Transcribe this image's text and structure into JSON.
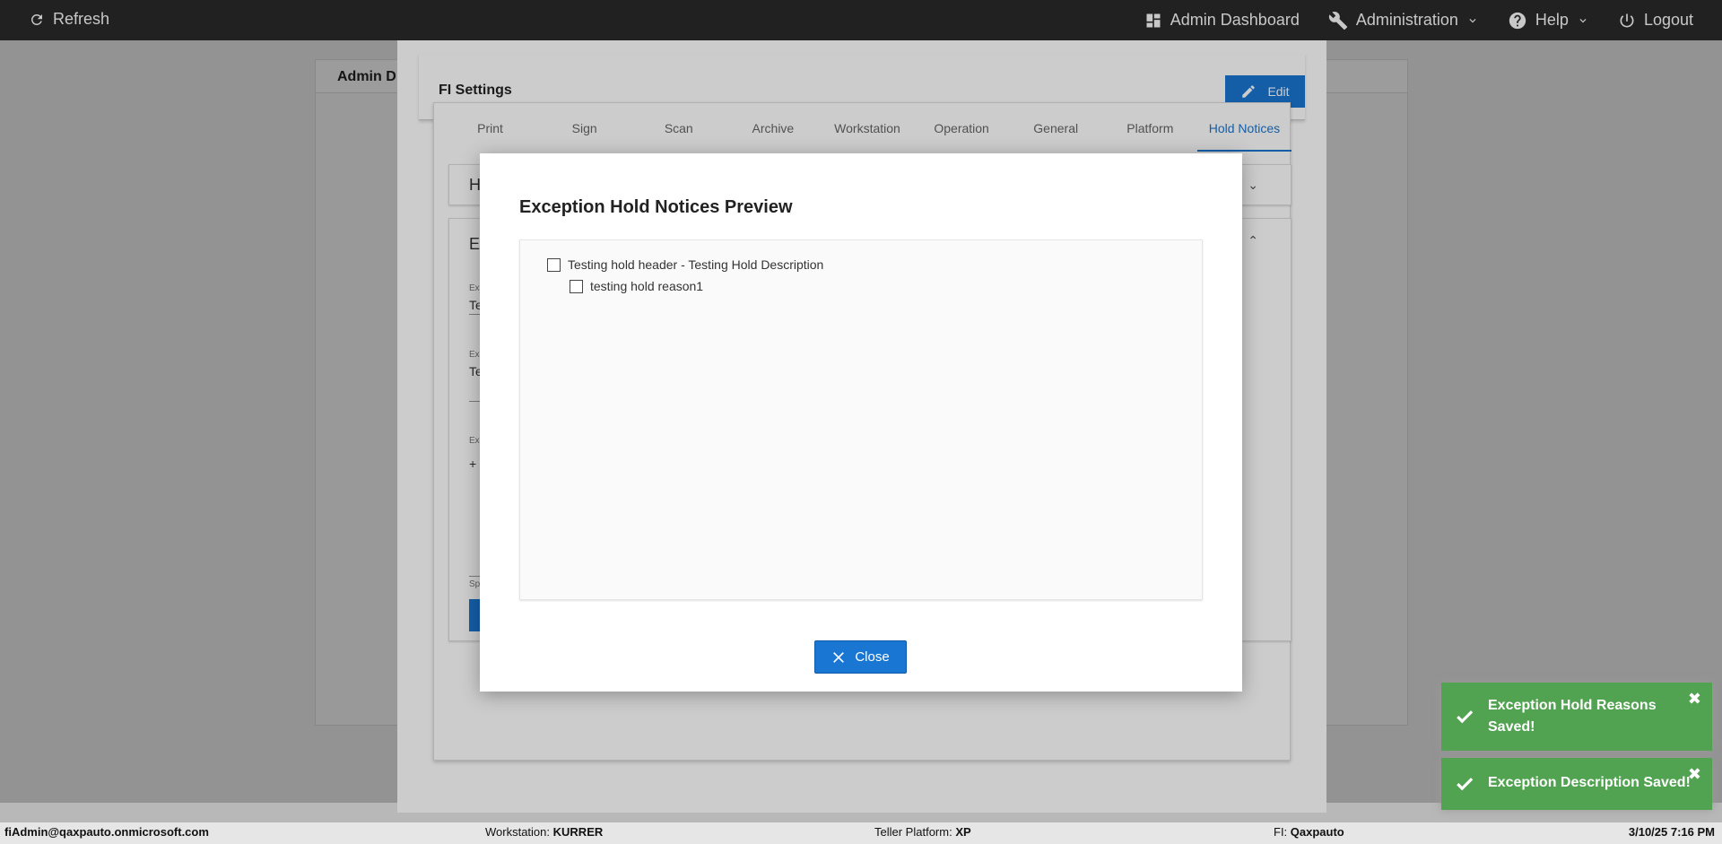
{
  "topbar": {
    "refresh": "Refresh",
    "admin_dashboard": "Admin Dashboard",
    "administration": "Administration",
    "help": "Help",
    "logout": "Logout"
  },
  "background": {
    "header_partial": "Admin D"
  },
  "fi_settings": {
    "title": "FI Settings",
    "edit_label": "Edit",
    "tabs": [
      "Print",
      "Sign",
      "Scan",
      "Archive",
      "Workstation",
      "Operation",
      "General",
      "Platform",
      "Hold Notices"
    ],
    "active_tab": "Hold Notices",
    "card1_label": "H",
    "card2_label": "E",
    "card2_small1": "Ex",
    "card2_val1": "Te",
    "card2_small2": "Ex",
    "card2_val2": "Te",
    "card2_small3": "Ex",
    "card2_val3": "+",
    "card2_small4": "Sp"
  },
  "dialog": {
    "title": "Exception Hold Notices Preview",
    "items": [
      {
        "label": "Testing hold header - Testing Hold Description",
        "level": 0
      },
      {
        "label": "testing hold reason1",
        "level": 1
      }
    ],
    "close_label": "Close"
  },
  "statusbar": {
    "user": "fiAdmin@qaxpauto.onmicrosoft.com",
    "workstation_label": "Workstation:",
    "workstation": "KURRER",
    "teller_label": "Teller Platform:",
    "teller": "XP",
    "fi_label": "FI:",
    "fi": "Qaxpauto",
    "datetime": "3/10/25 7:16 PM"
  },
  "toasts": [
    {
      "line1": "Exception Hold Reasons",
      "line2": "Saved!"
    },
    {
      "line1": "Exception Description Saved!"
    }
  ],
  "colors": {
    "primary": "#1976d2",
    "toast_success": "#51a351",
    "topbar": "#212121"
  }
}
